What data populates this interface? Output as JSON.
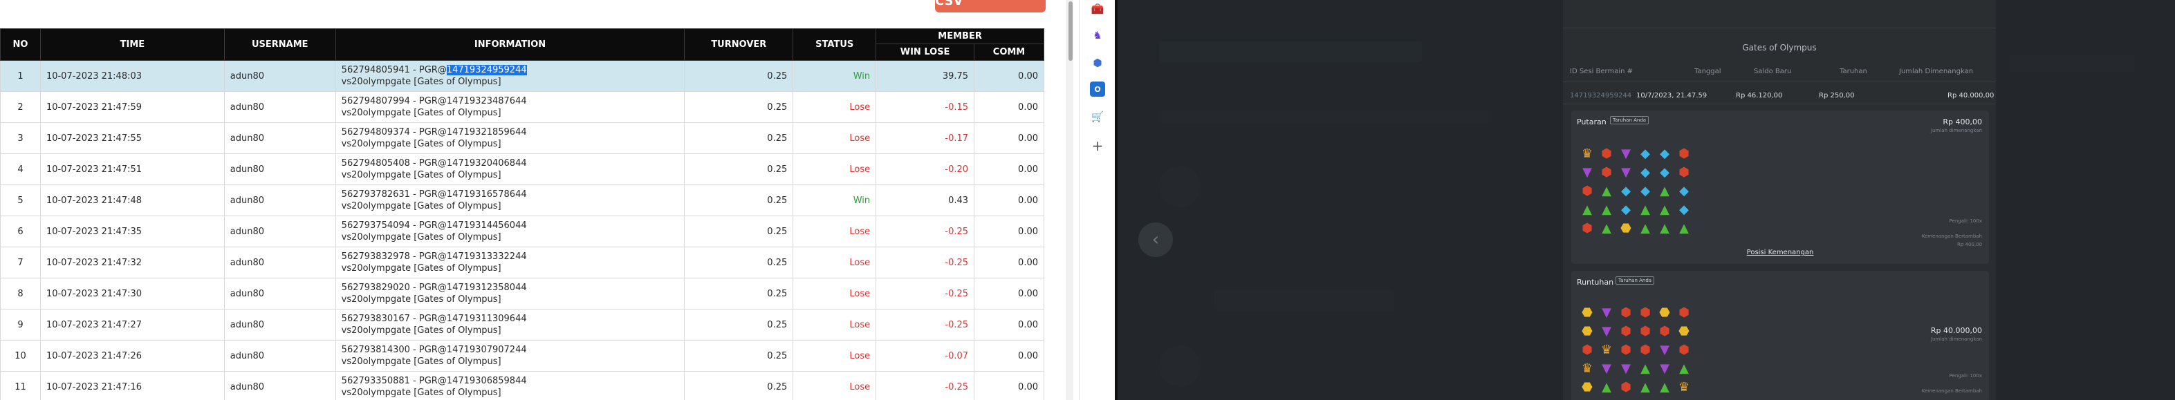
{
  "toolbar": {
    "export_label": "EXPORT TO CSV"
  },
  "table": {
    "headers": {
      "no": "NO",
      "time": "TIME",
      "username": "USERNAME",
      "information": "INFORMATION",
      "turnover": "TURNOVER",
      "status": "STATUS",
      "member": "MEMBER",
      "win_lose": "WIN LOSE",
      "comm": "COMM"
    },
    "rows": [
      {
        "no": "1",
        "time": "10-07-2023 21:48:03",
        "username": "adun80",
        "info_prefix": "562794805941 - PGR@",
        "info_highlight": "14719324959244",
        "info_line2": "vs20olympgate [Gates of Olympus]",
        "turnover": "0.25",
        "status": "Win",
        "win_lose": "39.75",
        "comm": "0.00"
      },
      {
        "no": "2",
        "time": "10-07-2023 21:47:59",
        "username": "adun80",
        "info_prefix": "562794807994 - PGR@14719323487644",
        "info_highlight": "",
        "info_line2": "vs20olympgate [Gates of Olympus]",
        "turnover": "0.25",
        "status": "Lose",
        "win_lose": "-0.15",
        "comm": "0.00"
      },
      {
        "no": "3",
        "time": "10-07-2023 21:47:55",
        "username": "adun80",
        "info_prefix": "562794809374 - PGR@14719321859644",
        "info_highlight": "",
        "info_line2": "vs20olympgate [Gates of Olympus]",
        "turnover": "0.25",
        "status": "Lose",
        "win_lose": "-0.17",
        "comm": "0.00"
      },
      {
        "no": "4",
        "time": "10-07-2023 21:47:51",
        "username": "adun80",
        "info_prefix": "562794805408 - PGR@14719320406844",
        "info_highlight": "",
        "info_line2": "vs20olympgate [Gates of Olympus]",
        "turnover": "0.25",
        "status": "Lose",
        "win_lose": "-0.20",
        "comm": "0.00"
      },
      {
        "no": "5",
        "time": "10-07-2023 21:47:48",
        "username": "adun80",
        "info_prefix": "562793782631 - PGR@14719316578644",
        "info_highlight": "",
        "info_line2": "vs20olympgate [Gates of Olympus]",
        "turnover": "0.25",
        "status": "Win",
        "win_lose": "0.43",
        "comm": "0.00"
      },
      {
        "no": "6",
        "time": "10-07-2023 21:47:35",
        "username": "adun80",
        "info_prefix": "562793754094 - PGR@14719314456044",
        "info_highlight": "",
        "info_line2": "vs20olympgate [Gates of Olympus]",
        "turnover": "0.25",
        "status": "Lose",
        "win_lose": "-0.25",
        "comm": "0.00"
      },
      {
        "no": "7",
        "time": "10-07-2023 21:47:32",
        "username": "adun80",
        "info_prefix": "562793832978 - PGR@14719313332244",
        "info_highlight": "",
        "info_line2": "vs20olympgate [Gates of Olympus]",
        "turnover": "0.25",
        "status": "Lose",
        "win_lose": "-0.25",
        "comm": "0.00"
      },
      {
        "no": "8",
        "time": "10-07-2023 21:47:30",
        "username": "adun80",
        "info_prefix": "562793829020 - PGR@14719312358044",
        "info_highlight": "",
        "info_line2": "vs20olympgate [Gates of Olympus]",
        "turnover": "0.25",
        "status": "Lose",
        "win_lose": "-0.25",
        "comm": "0.00"
      },
      {
        "no": "9",
        "time": "10-07-2023 21:47:27",
        "username": "adun80",
        "info_prefix": "562793830167 - PGR@14719311309644",
        "info_highlight": "",
        "info_line2": "vs20olympgate [Gates of Olympus]",
        "turnover": "0.25",
        "status": "Lose",
        "win_lose": "-0.25",
        "comm": "0.00"
      },
      {
        "no": "10",
        "time": "10-07-2023 21:47:26",
        "username": "adun80",
        "info_prefix": "562793814300 - PGR@14719307907244",
        "info_highlight": "",
        "info_line2": "vs20olympgate [Gates of Olympus]",
        "turnover": "0.25",
        "status": "Lose",
        "win_lose": "-0.07",
        "comm": "0.00"
      },
      {
        "no": "11",
        "time": "10-07-2023 21:47:16",
        "username": "adun80",
        "info_prefix": "562793350881 - PGR@14719306859844",
        "info_highlight": "",
        "info_line2": "vs20olympgate [Gates of Olympus]",
        "turnover": "0.25",
        "status": "Lose",
        "win_lose": "-0.25",
        "comm": "0.00"
      }
    ]
  },
  "sidebar": {
    "icons": [
      "toolbox-icon",
      "chess-icon",
      "extension-icon",
      "outlook-icon",
      "cart-icon",
      "add-icon"
    ]
  },
  "game_detail": {
    "title": "Gates of Olympus",
    "headers": {
      "round_id": "ID Sesi Bermain #",
      "date": "Tanggal",
      "new_balance": "Saldo Baru",
      "bet": "Taruhan",
      "total_won": "Jumlah Dimenangkan"
    },
    "values": {
      "round_id": "14719324959244",
      "date": "10/7/2023, 21.47.59",
      "new_balance": "Rp 46.120,00",
      "bet": "Rp 250,00",
      "total_won": "Rp 40.000,00"
    },
    "spin": {
      "label": "Putaran",
      "tag": "Taruhan Anda",
      "amount": "Rp 400,00",
      "amount_sub": "Jumlah dimenangkan",
      "small1": "Pengali: 100x",
      "small2": "Kemenangan Bertambah",
      "small3": "Rp 400,00",
      "payline_link": "Posisi Kemenangan"
    },
    "tumble": {
      "label": "Runtuhan",
      "tag": "Taruhan Anda",
      "amount": "Rp 40.000,00",
      "amount_sub": "Jumlah dimenangkan",
      "small1": "Pengali: 100x",
      "small2": "Kemenangan Bertambah"
    }
  }
}
